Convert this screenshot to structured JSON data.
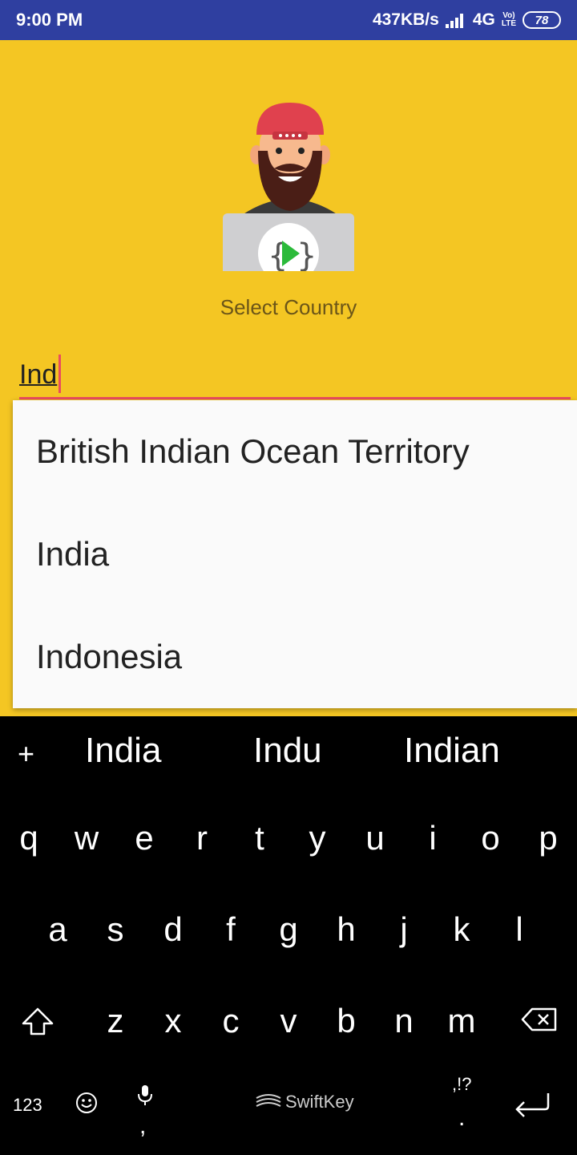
{
  "status_bar": {
    "time": "9:00 PM",
    "speed": "437KB/s",
    "network": "4G",
    "volte_top": "Vo)",
    "volte_bottom": "LTE",
    "battery": "78"
  },
  "main": {
    "select_label": "Select Country",
    "input_value": "Ind"
  },
  "dropdown": {
    "items": [
      "British Indian Ocean Territory",
      "India",
      "Indonesia"
    ]
  },
  "keyboard": {
    "suggestions": [
      "India",
      "Indu",
      "Indian"
    ],
    "row1": [
      "q",
      "w",
      "e",
      "r",
      "t",
      "y",
      "u",
      "i",
      "o",
      "p"
    ],
    "row2": [
      "a",
      "s",
      "d",
      "f",
      "g",
      "h",
      "j",
      "k",
      "l"
    ],
    "row3": [
      "z",
      "x",
      "c",
      "v",
      "b",
      "n",
      "m"
    ],
    "numbers_label": "123",
    "comma_label": ",",
    "brand": "SwiftKey",
    "punct_label": ",!?",
    "period_label": "."
  },
  "colors": {
    "status_bar": "#2F3FA0",
    "background": "#F4C623",
    "accent": "#E94C5E",
    "dropdown_bg": "#FAFAFA",
    "keyboard_bg": "#000000"
  }
}
